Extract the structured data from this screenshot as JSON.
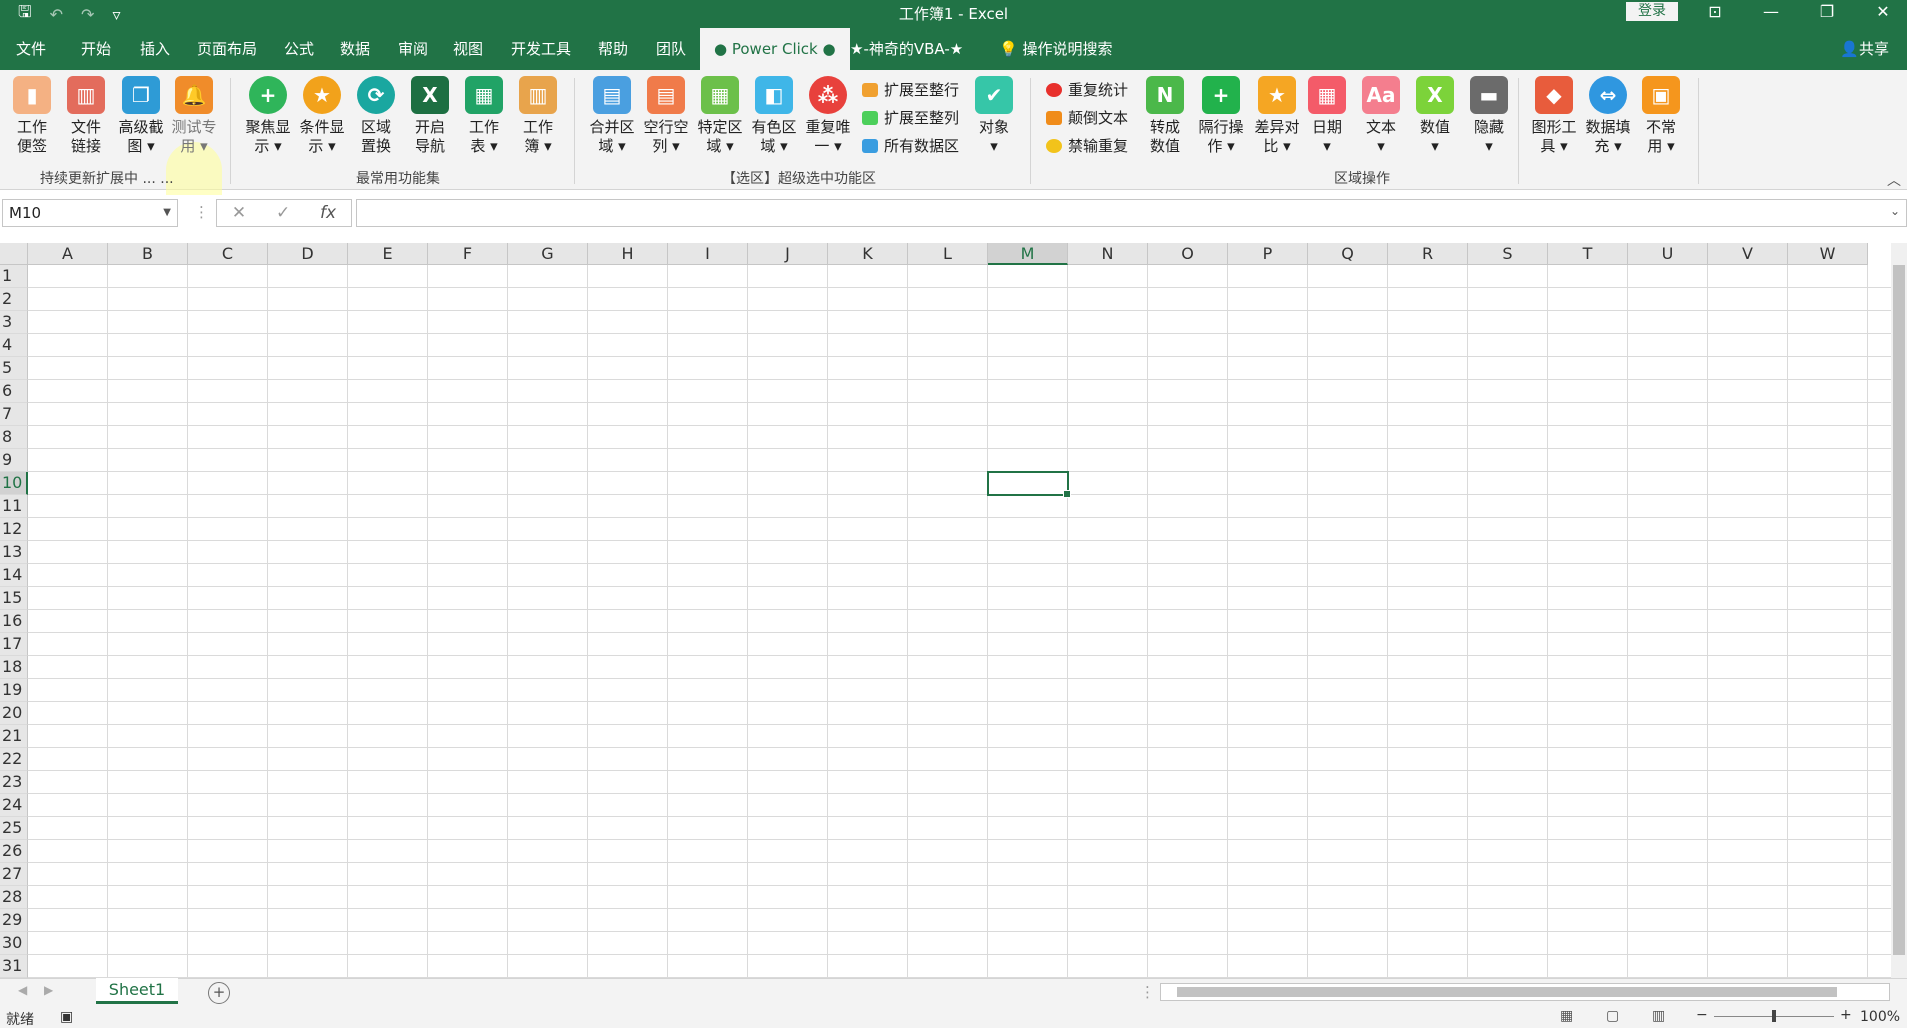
{
  "title": "工作簿1  -  Excel",
  "login": "登录",
  "qat": {
    "save": "🖫",
    "undo": "↶",
    "redo": "↷",
    "more": "▿"
  },
  "window": {
    "layout": "⊡",
    "min": "—",
    "restore": "❐",
    "close": "✕"
  },
  "tabs": [
    "文件",
    "开始",
    "插入",
    "页面布局",
    "公式",
    "数据",
    "审阅",
    "视图",
    "开发工具",
    "帮助",
    "团队",
    "● Power Click ●",
    "★-神奇的VBA-★",
    "操作说明搜索"
  ],
  "share": "共享",
  "ribbon": {
    "b1": "工作\n便签",
    "b2": "文件\n链接",
    "b3": "高级截\n图 ▾",
    "b4": "测试专\n用 ▾",
    "b5": "聚焦显\n示 ▾",
    "b6": "条件显\n示 ▾",
    "b7": "区域\n置换",
    "b8": "开启\n导航",
    "b9": "工作\n表 ▾",
    "b10": "工作\n簿 ▾",
    "b11": "合并区\n域 ▾",
    "b12": "空行空\n列 ▾",
    "b13": "特定区\n域 ▾",
    "b14": "有色区\n域 ▾",
    "b15": "重复唯\n一 ▾",
    "s1": "扩展至整行",
    "s2": "扩展至整列",
    "s3": "所有数据区",
    "b16": "对象\n▾",
    "s4": "重复统计",
    "s5": "颠倒文本",
    "s6": "禁输重复",
    "b17": "转成\n数值",
    "b18": "隔行操\n作 ▾",
    "b19": "差异对\n比 ▾",
    "b20": "日期\n▾",
    "b21": "文本\n▾",
    "b22": "数值\n▾",
    "b23": "隐藏\n▾",
    "b24": "图形工\n具 ▾",
    "b25": "数据填\n充 ▾",
    "b26": "不常\n用 ▾",
    "g1": "持续更新扩展中 ... ...",
    "g2": "最常用功能集",
    "g3": "【选区】超级选中功能区",
    "g4": "区域操作"
  },
  "namebox": "M10",
  "fx": "fx",
  "columns": [
    "A",
    "B",
    "C",
    "D",
    "E",
    "F",
    "G",
    "H",
    "I",
    "J",
    "K",
    "L",
    "M",
    "N",
    "O",
    "P",
    "Q",
    "R",
    "S",
    "T",
    "U",
    "V",
    "W"
  ],
  "rows": [
    "1",
    "2",
    "3",
    "4",
    "5",
    "6",
    "7",
    "8",
    "9",
    "10",
    "11",
    "12",
    "13",
    "14",
    "15",
    "16",
    "17",
    "18",
    "19",
    "20",
    "21",
    "22",
    "23",
    "24",
    "25",
    "26",
    "27",
    "28",
    "29",
    "30",
    "31"
  ],
  "selected": {
    "col": "M",
    "row": "10"
  },
  "sheet_tab": "Sheet1",
  "status": {
    "ready": "就绪",
    "zoom": "100%"
  }
}
